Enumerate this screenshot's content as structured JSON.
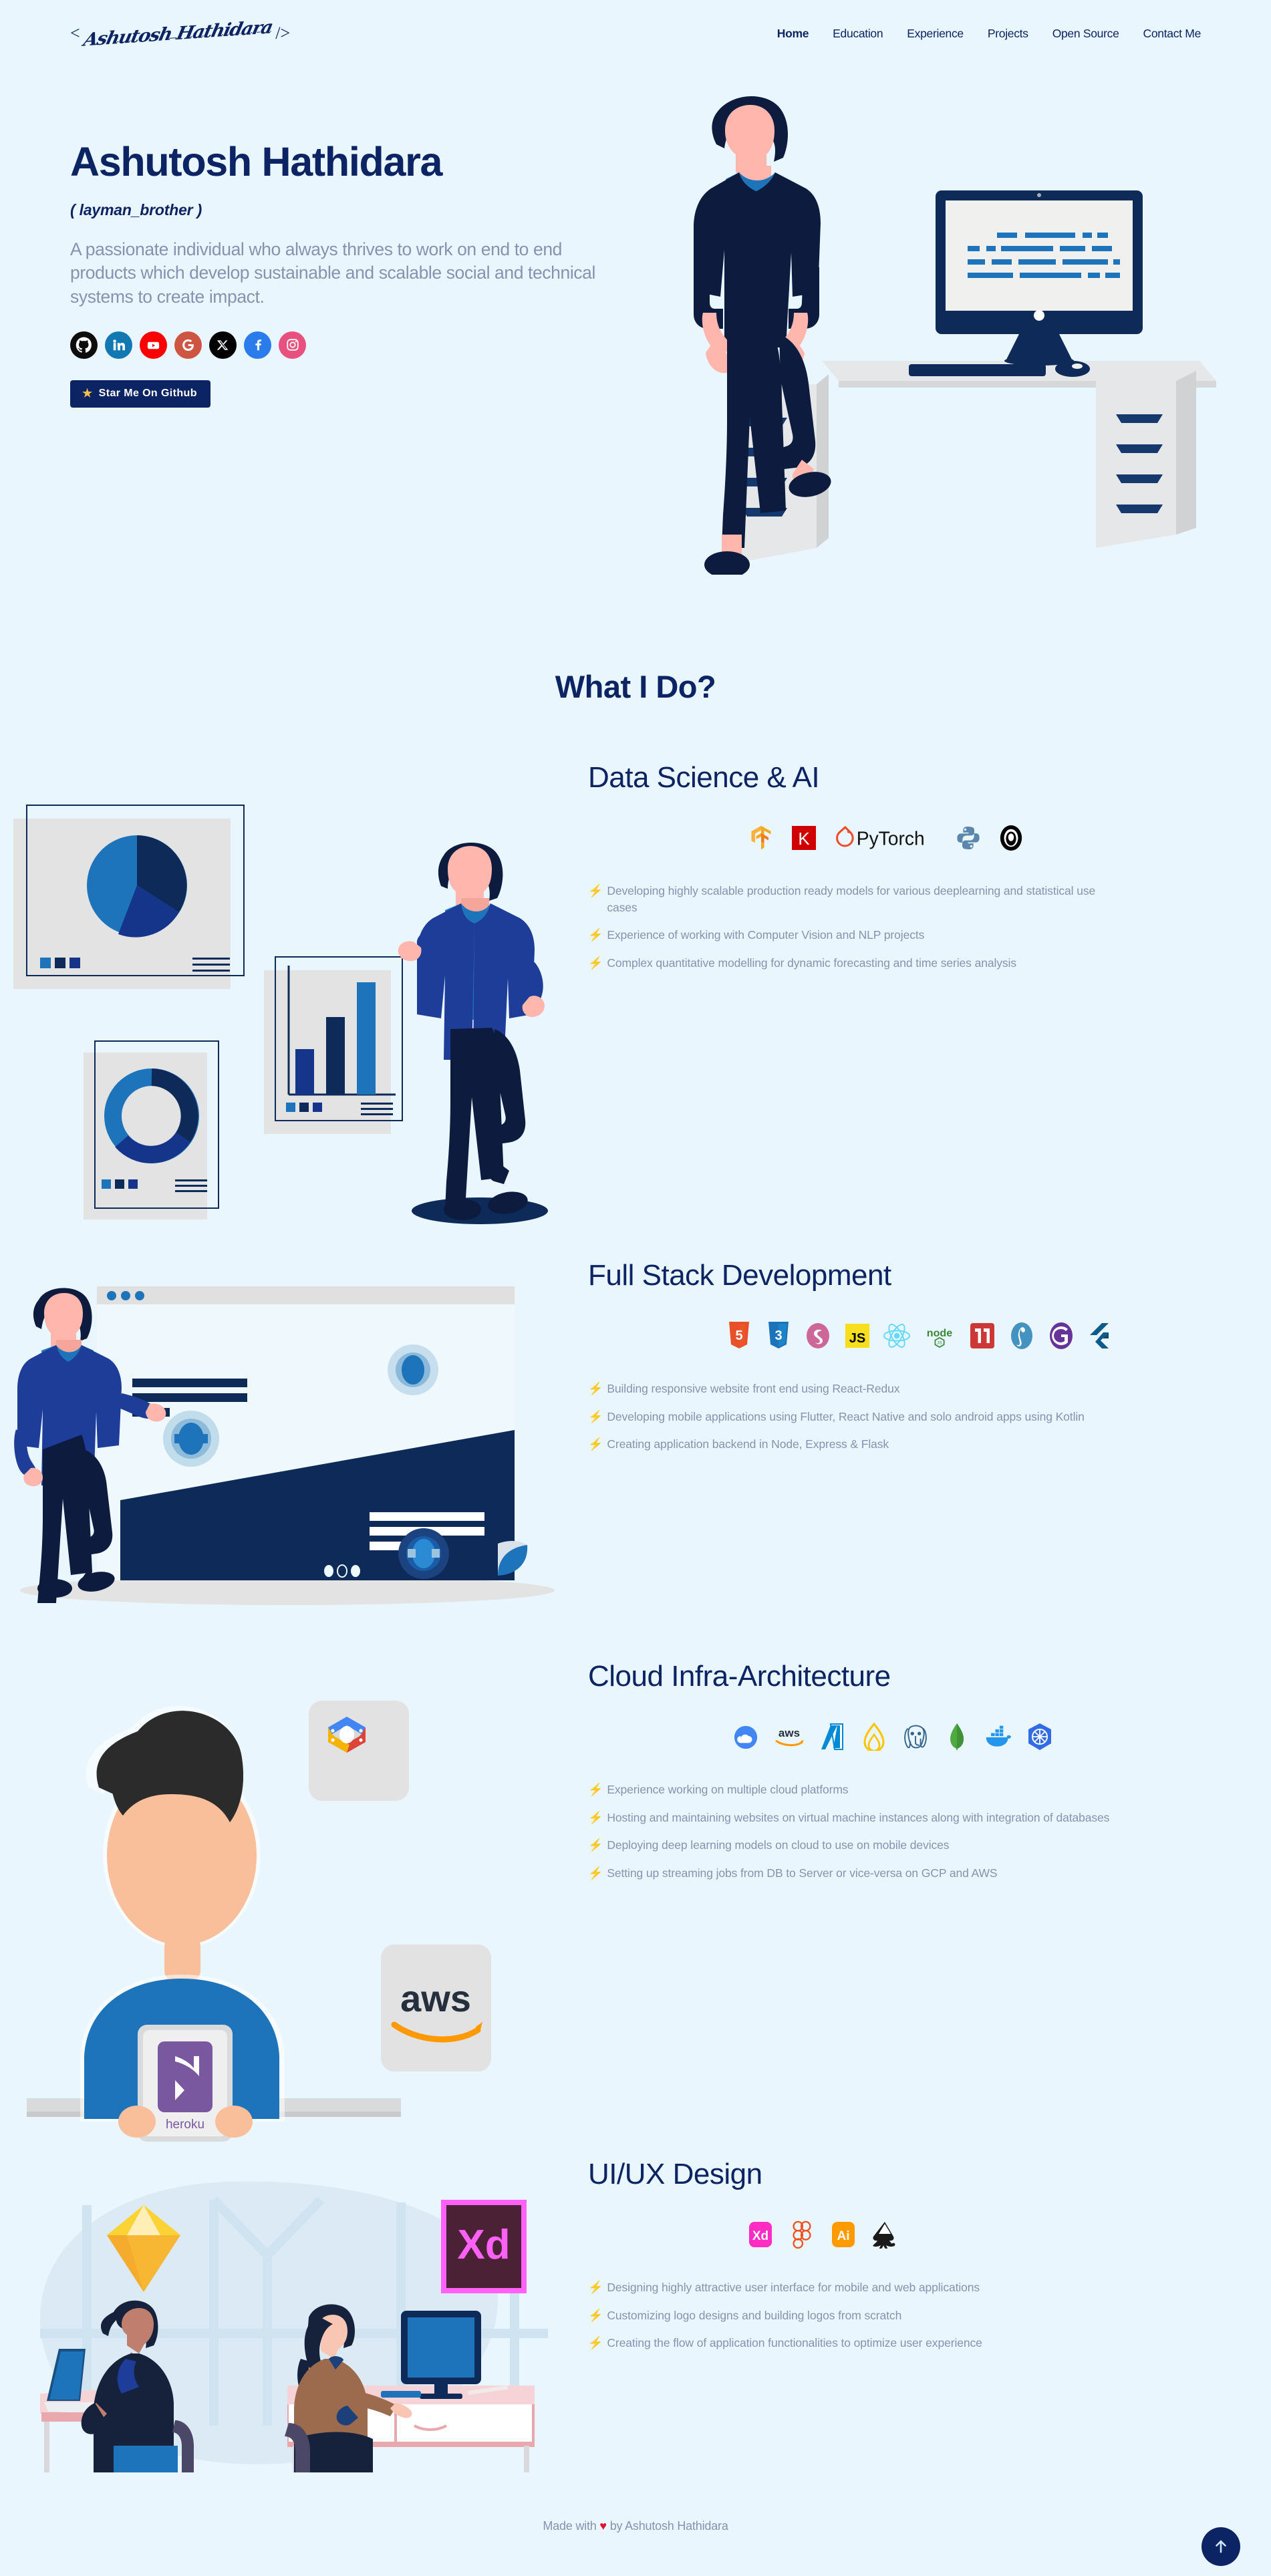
{
  "nav": {
    "logo_bracket_open": "<",
    "logo_text": "Ashutosh Hathidara",
    "logo_bracket_close": "/>",
    "links": [
      {
        "label": "Home",
        "active": true
      },
      {
        "label": "Education",
        "active": false
      },
      {
        "label": "Experience",
        "active": false
      },
      {
        "label": "Projects",
        "active": false
      },
      {
        "label": "Open Source",
        "active": false
      },
      {
        "label": "Contact Me",
        "active": false
      }
    ]
  },
  "hero": {
    "title": "Ashutosh Hathidara",
    "handle": "( layman_brother )",
    "description": "A passionate individual who always thrives to work on end to end products which develop sustainable and scalable social and technical systems to create impact.",
    "socials": [
      {
        "name": "github-icon",
        "color": "#0d0d0d"
      },
      {
        "name": "linkedin-icon",
        "color": "#1178b3"
      },
      {
        "name": "youtube-icon",
        "color": "#fb0103"
      },
      {
        "name": "google-icon",
        "color": "#cf5543"
      },
      {
        "name": "x-twitter-icon",
        "color": "#000000"
      },
      {
        "name": "facebook-icon",
        "color": "#2a7ced"
      },
      {
        "name": "instagram-icon",
        "color": "#e8507f"
      }
    ],
    "star_button": {
      "star_glyph": "★",
      "label": "Star Me On Github"
    }
  },
  "section_heading": "What I Do?",
  "skills": [
    {
      "title": "Data Science & AI",
      "icons": [
        "tensorflow-icon",
        "keras-icon",
        "pytorch-icon",
        "python-icon",
        "opencv-icon"
      ],
      "points": [
        "Developing highly scalable production ready models for various deeplearning and statistical use cases",
        "Experience of working with Computer Vision and NLP projects",
        "Complex quantitative modelling for dynamic forecasting and time series analysis"
      ]
    },
    {
      "title": "Full Stack Development",
      "icons": [
        "html5-icon",
        "css3-icon",
        "sass-icon",
        "javascript-icon",
        "react-icon",
        "nodejs-icon",
        "npm-icon",
        "python-flask-icon",
        "gatsby-icon",
        "flutter-icon"
      ],
      "points": [
        "Building responsive website front end using React-Redux",
        "Developing mobile applications using Flutter, React Native and solo android apps using Kotlin",
        "Creating application backend in Node, Express & Flask"
      ]
    },
    {
      "title": "Cloud Infra-Architecture",
      "icons": [
        "gcp-icon",
        "aws-icon",
        "azure-icon",
        "firebase-icon",
        "postgresql-icon",
        "mongodb-icon",
        "docker-icon",
        "kubernetes-icon"
      ],
      "points": [
        "Experience working on multiple cloud platforms",
        "Hosting and maintaining websites on virtual machine instances along with integration of databases",
        "Deploying deep learning models on cloud to use on mobile devices",
        "Setting up streaming jobs from DB to Server or vice-versa on GCP and AWS"
      ]
    },
    {
      "title": "UI/UX Design",
      "icons": [
        "adobe-xd-icon",
        "figma-icon",
        "adobe-illustrator-icon",
        "inkscape-icon"
      ],
      "points": [
        "Designing highly attractive user interface for mobile and web applications",
        "Customizing logo designs and building logos from scratch",
        "Creating the flow of application functionalities to optimize user experience"
      ]
    }
  ],
  "footer": {
    "prefix": "Made with ",
    "heart": "♥",
    "suffix": " by Ashutosh Hathidara"
  },
  "colors": {
    "background": "#eaf6fd",
    "brand_navy": "#0c2463",
    "muted_text": "#8792b0",
    "star_yellow": "#f2c14e",
    "heart_red": "#e0112b"
  }
}
